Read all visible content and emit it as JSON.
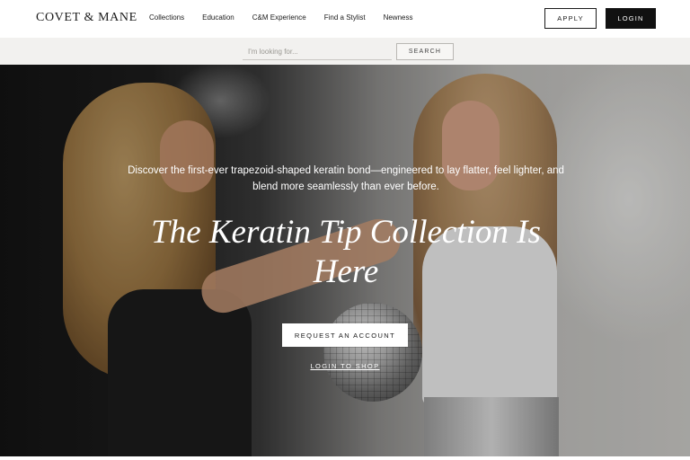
{
  "header": {
    "logo": "COVET & MANE",
    "nav": [
      "Collections",
      "Education",
      "C&M Experience",
      "Find a Stylist",
      "Newness"
    ],
    "apply_label": "APPLY",
    "login_label": "LOGIN"
  },
  "search": {
    "placeholder": "I'm looking for...",
    "button_label": "SEARCH"
  },
  "hero": {
    "subtitle": "Discover the first-ever trapezoid-shaped keratin bond—engineered to lay flatter, feel lighter, and blend more seamlessly than ever before.",
    "title": "The Keratin Tip Collection Is Here",
    "primary_cta": "REQUEST AN ACCOUNT",
    "secondary_cta": "LOGIN TO SHOP"
  }
}
